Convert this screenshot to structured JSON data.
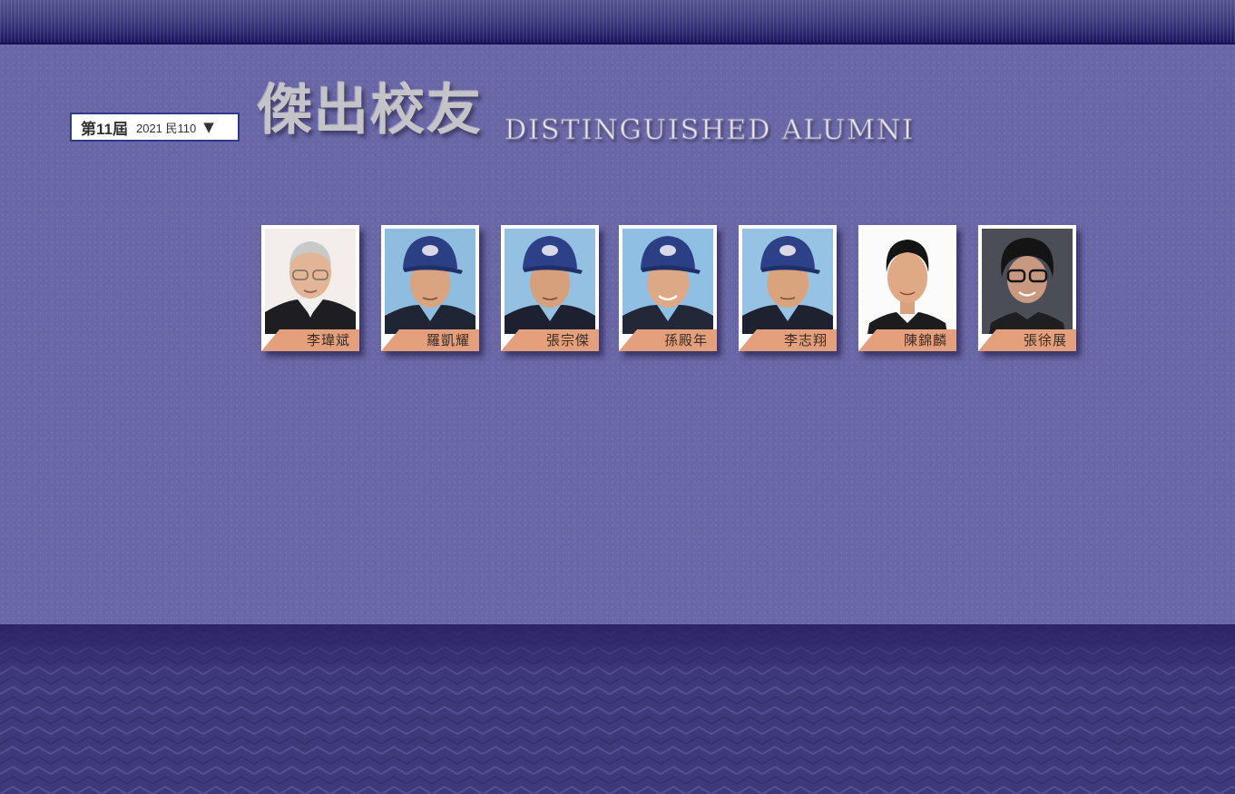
{
  "header": {
    "title_zh": "傑出校友",
    "title_en": "DISTINGUISHED ALUMNI"
  },
  "selector": {
    "term": "第11屆",
    "year": "2021 民110",
    "caret_icon": "triangle-down-icon"
  },
  "theme": {
    "background": "#6a67a6",
    "top_bar": "#1b1660",
    "bottom_band": "#3e3a7a",
    "name_tab": "#e4a07d"
  },
  "alumni": [
    {
      "name": "李瑋斌",
      "photo": "portrait-glasses-suit"
    },
    {
      "name": "羅凱耀",
      "photo": "portrait-baseball-cap"
    },
    {
      "name": "張宗傑",
      "photo": "portrait-baseball-cap"
    },
    {
      "name": "孫殿年",
      "photo": "portrait-baseball-cap"
    },
    {
      "name": "李志翔",
      "photo": "portrait-baseball-cap"
    },
    {
      "name": "陳錦麟",
      "photo": "portrait-white-background"
    },
    {
      "name": "張徐展",
      "photo": "portrait-glasses-dark-background"
    }
  ]
}
